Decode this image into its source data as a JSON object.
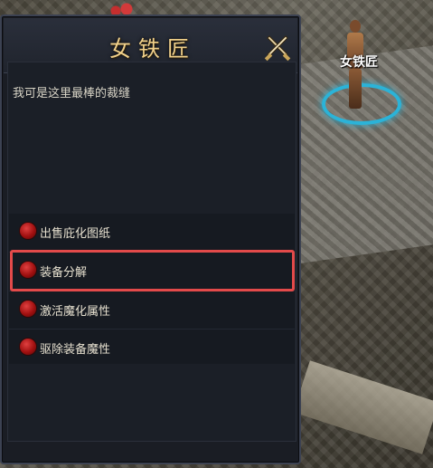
{
  "dialog": {
    "title": "女铁匠",
    "greeting": "我可是这里最棒的裁缝",
    "close_icon": "crossed-swords-icon",
    "accent_color": "#f0d08a",
    "options": [
      {
        "label": "出售庇化图纸"
      },
      {
        "label": "装备分解",
        "highlighted": true
      },
      {
        "label": "激活魔化属性"
      },
      {
        "label": "驱除装备魔性"
      }
    ],
    "highlight_color": "#e34a4a",
    "bullet_icon": "red-orb-icon"
  },
  "scene": {
    "npc_name": "女铁匠",
    "ring_color": "#2bb3d8"
  }
}
